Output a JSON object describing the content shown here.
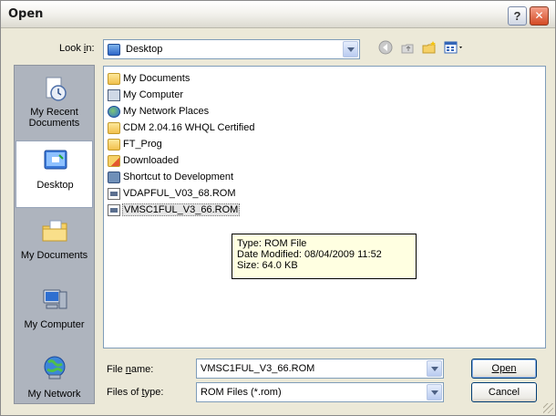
{
  "window": {
    "title": "Open",
    "help_label": "?",
    "close_label": "✕"
  },
  "lookin": {
    "label": "Look in:",
    "value": "Desktop"
  },
  "toolbar": {
    "icons": [
      "back-icon",
      "up-folder-icon",
      "new-folder-icon",
      "views-icon"
    ]
  },
  "places": [
    {
      "label": "My Recent Documents"
    },
    {
      "label": "Desktop"
    },
    {
      "label": "My Documents"
    },
    {
      "label": "My Computer"
    },
    {
      "label": "My Network"
    }
  ],
  "files": [
    {
      "name": "My Documents",
      "icon": "my-documents-icon"
    },
    {
      "name": "My Computer",
      "icon": "my-computer-icon"
    },
    {
      "name": "My Network Places",
      "icon": "network-places-icon"
    },
    {
      "name": "CDM 2.04.16 WHQL Certified",
      "icon": "folder-icon"
    },
    {
      "name": "FT_Prog",
      "icon": "folder-icon"
    },
    {
      "name": "Downloaded",
      "icon": "folder-icon"
    },
    {
      "name": "Shortcut to Development",
      "icon": "shortcut-icon"
    },
    {
      "name": "VDAPFUL_V03_68.ROM",
      "icon": "rom-file-icon"
    },
    {
      "name": "VMSC1FUL_V3_66.ROM",
      "icon": "rom-file-icon",
      "selected": true
    }
  ],
  "tooltip": {
    "type": "Type: ROM File",
    "modified": "Date Modified: 08/04/2009 11:52",
    "size": "Size: 64.0 KB"
  },
  "filename": {
    "label": "File name:",
    "value": "VMSC1FUL_V3_66.ROM"
  },
  "filetype": {
    "label": "Files of type:",
    "value": "ROM Files (*.rom)"
  },
  "buttons": {
    "open": "Open",
    "cancel": "Cancel"
  }
}
